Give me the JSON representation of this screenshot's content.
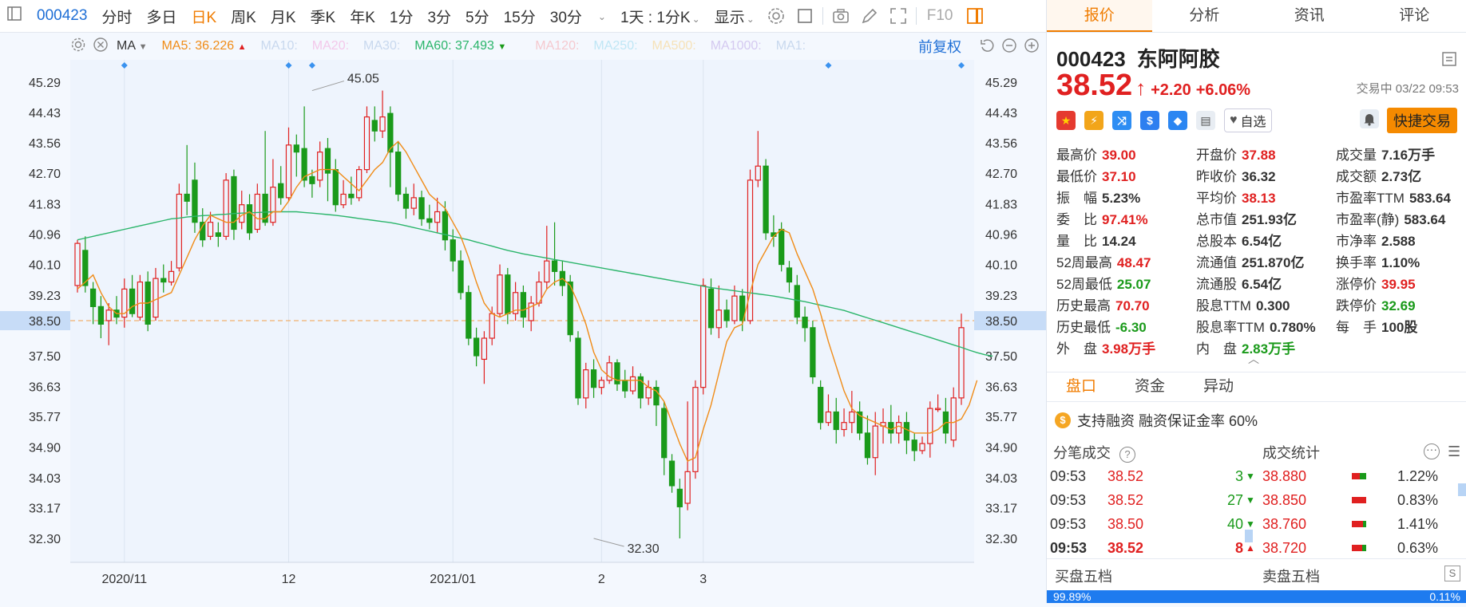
{
  "toolbar": {
    "code": "000423",
    "items": [
      "分时",
      "多日",
      "日K",
      "周K",
      "月K",
      "季K",
      "年K",
      "1分",
      "3分",
      "5分",
      "15分",
      "30分"
    ],
    "active_index": 2,
    "period": "1天 : 1分K",
    "display": "显示",
    "f10": "F10"
  },
  "mabar": {
    "type": "MA",
    "ma5": "MA5: 36.226",
    "ma10": "MA10:",
    "ma20": "MA20:",
    "ma30": "MA30:",
    "ma60": "MA60: 37.493",
    "ma120": "MA120:",
    "ma250": "MA250:",
    "ma500": "MA500:",
    "ma1000": "MA1000:",
    "ma1": "MA1:",
    "fuquan": "前复权"
  },
  "colors": {
    "up": "#e02020",
    "down": "#1a9a1a",
    "ma5": "#f08c18",
    "ma60": "#2bb56b",
    "accent": "#f07c00",
    "blue": "#1f6fd6"
  },
  "chart_data": {
    "type": "candlestick",
    "title": "",
    "y_ticks": [
      "45.29",
      "44.43",
      "43.56",
      "42.70",
      "41.83",
      "40.96",
      "40.10",
      "39.23",
      "38.50",
      "37.50",
      "36.63",
      "35.77",
      "34.90",
      "34.03",
      "33.17",
      "32.30"
    ],
    "x_ticks": [
      {
        "label": "2020/11",
        "index": 6
      },
      {
        "label": "12",
        "index": 27
      },
      {
        "label": "2021/01",
        "index": 48
      },
      {
        "label": "2",
        "index": 67
      },
      {
        "label": "3",
        "index": 80
      }
    ],
    "ylim": [
      31.6,
      46.1
    ],
    "current_price": 38.5,
    "high_annotation": {
      "value": "45.05",
      "index": 30
    },
    "low_annotation": {
      "value": "32.30",
      "index": 66
    },
    "ohlc": [
      [
        39.5,
        40.7,
        40.8,
        39.3
      ],
      [
        40.5,
        39.5,
        40.9,
        39.3
      ],
      [
        39.4,
        38.9,
        39.6,
        38.4
      ],
      [
        38.9,
        38.4,
        39.2,
        38.0
      ],
      [
        38.5,
        38.8,
        39.0,
        37.8
      ],
      [
        38.8,
        38.6,
        39.2,
        38.4
      ],
      [
        38.6,
        39.4,
        39.7,
        38.3
      ],
      [
        39.4,
        38.7,
        39.8,
        38.6
      ],
      [
        38.6,
        39.6,
        39.8,
        38.5
      ],
      [
        39.6,
        38.4,
        39.9,
        38.2
      ],
      [
        38.6,
        39.7,
        40.0,
        38.5
      ],
      [
        39.7,
        39.6,
        40.1,
        39.3
      ],
      [
        39.6,
        39.9,
        40.2,
        39.5
      ],
      [
        40.0,
        42.1,
        42.4,
        39.9
      ],
      [
        42.1,
        41.9,
        43.5,
        41.5
      ],
      [
        42.5,
        41.3,
        43.0,
        41.0
      ],
      [
        41.3,
        40.8,
        41.7,
        40.6
      ],
      [
        40.9,
        41.3,
        41.6,
        40.8
      ],
      [
        41.0,
        40.9,
        41.3,
        40.6
      ],
      [
        40.9,
        42.5,
        42.7,
        40.8
      ],
      [
        42.6,
        41.1,
        42.8,
        40.8
      ],
      [
        41.3,
        41.8,
        42.2,
        41.1
      ],
      [
        41.8,
        41.0,
        42.1,
        40.8
      ],
      [
        41.1,
        42.1,
        42.4,
        41.0
      ],
      [
        42.1,
        41.3,
        43.9,
        41.2
      ],
      [
        41.3,
        42.3,
        43.1,
        41.2
      ],
      [
        42.4,
        42.0,
        42.9,
        41.8
      ],
      [
        42.0,
        43.5,
        44.0,
        41.9
      ],
      [
        43.5,
        43.3,
        43.8,
        42.6
      ],
      [
        43.4,
        42.5,
        44.6,
        42.3
      ],
      [
        42.6,
        42.4,
        42.8,
        42.0
      ],
      [
        42.5,
        43.3,
        43.6,
        42.3
      ],
      [
        43.4,
        42.7,
        43.7,
        41.9
      ],
      [
        42.8,
        41.8,
        43.1,
        41.6
      ],
      [
        41.8,
        42.1,
        42.5,
        41.7
      ],
      [
        42.1,
        42.0,
        42.6,
        41.8
      ],
      [
        42.0,
        42.8,
        42.9,
        41.9
      ],
      [
        42.8,
        44.3,
        44.6,
        42.7
      ],
      [
        44.2,
        43.9,
        44.6,
        43.6
      ],
      [
        43.9,
        44.3,
        45.05,
        43.7
      ],
      [
        44.4,
        43.3,
        44.6,
        42.3
      ],
      [
        43.3,
        42.1,
        43.6,
        41.9
      ],
      [
        42.1,
        41.7,
        42.3,
        41.4
      ],
      [
        41.7,
        42.0,
        42.4,
        41.5
      ],
      [
        42.0,
        41.4,
        42.2,
        41.2
      ],
      [
        41.4,
        41.3,
        41.8,
        41.1
      ],
      [
        41.3,
        41.6,
        42.0,
        41.0
      ],
      [
        41.6,
        40.8,
        41.9,
        40.5
      ],
      [
        40.8,
        40.2,
        41.1,
        39.9
      ],
      [
        40.2,
        39.3,
        40.5,
        39.1
      ],
      [
        39.3,
        38.0,
        39.5,
        37.8
      ],
      [
        38.0,
        37.5,
        38.3,
        37.2
      ],
      [
        37.4,
        38.0,
        38.2,
        36.7
      ],
      [
        38.0,
        38.7,
        38.9,
        37.8
      ],
      [
        38.7,
        39.8,
        40.1,
        38.6
      ],
      [
        39.8,
        38.7,
        40.0,
        38.4
      ],
      [
        38.7,
        39.3,
        39.6,
        38.5
      ],
      [
        39.3,
        38.6,
        39.5,
        38.3
      ],
      [
        38.5,
        39.0,
        39.2,
        38.2
      ],
      [
        39.0,
        39.6,
        39.9,
        38.9
      ],
      [
        39.6,
        40.2,
        41.2,
        39.4
      ],
      [
        40.2,
        39.9,
        41.3,
        39.5
      ],
      [
        39.9,
        39.5,
        40.2,
        39.2
      ],
      [
        39.6,
        38.1,
        39.8,
        37.9
      ],
      [
        38.0,
        36.3,
        38.2,
        36.1
      ],
      [
        36.3,
        37.1,
        37.3,
        36.0
      ],
      [
        37.1,
        36.6,
        37.4,
        36.3
      ],
      [
        36.6,
        36.8,
        36.9,
        36.4
      ],
      [
        36.8,
        37.3,
        37.5,
        36.7
      ],
      [
        37.3,
        36.7,
        37.4,
        36.5
      ],
      [
        36.8,
        36.5,
        37.1,
        36.3
      ],
      [
        36.5,
        36.9,
        37.2,
        36.4
      ],
      [
        36.9,
        36.3,
        37.0,
        36.0
      ],
      [
        36.3,
        36.6,
        36.8,
        36.1
      ],
      [
        36.6,
        36.1,
        36.8,
        35.5
      ],
      [
        36.0,
        34.6,
        36.2,
        34.1
      ],
      [
        34.5,
        33.8,
        34.7,
        33.6
      ],
      [
        33.7,
        33.2,
        34.0,
        32.3
      ],
      [
        33.3,
        34.2,
        36.2,
        33.1
      ],
      [
        34.2,
        36.6,
        36.8,
        34.0
      ],
      [
        36.6,
        39.5,
        39.7,
        36.4
      ],
      [
        39.4,
        38.3,
        39.7,
        38.1
      ],
      [
        38.3,
        38.8,
        39.5,
        38.0
      ],
      [
        38.8,
        38.5,
        39.1,
        38.3
      ],
      [
        38.5,
        39.2,
        39.5,
        38.4
      ],
      [
        39.2,
        38.5,
        39.4,
        38.2
      ],
      [
        38.5,
        42.5,
        42.8,
        38.4
      ],
      [
        42.5,
        42.9,
        43.9,
        42.3
      ],
      [
        42.9,
        41.0,
        43.1,
        40.8
      ],
      [
        41.0,
        40.9,
        41.5,
        40.6
      ],
      [
        41.1,
        40.1,
        41.3,
        39.9
      ],
      [
        40.0,
        39.6,
        40.2,
        39.3
      ],
      [
        39.5,
        38.6,
        39.8,
        38.4
      ],
      [
        38.6,
        38.3,
        38.9,
        37.9
      ],
      [
        38.3,
        36.9,
        38.5,
        36.7
      ],
      [
        36.6,
        35.6,
        36.8,
        35.4
      ],
      [
        35.6,
        35.9,
        36.4,
        35.5
      ],
      [
        35.9,
        35.4,
        36.3,
        35.0
      ],
      [
        35.4,
        35.6,
        36.0,
        35.2
      ],
      [
        35.6,
        35.9,
        36.5,
        35.3
      ],
      [
        35.9,
        35.3,
        36.2,
        35.1
      ],
      [
        35.3,
        34.6,
        35.8,
        34.4
      ],
      [
        34.6,
        35.5,
        35.9,
        34.1
      ],
      [
        35.5,
        35.6,
        36.0,
        35.0
      ],
      [
        35.6,
        35.3,
        36.1,
        35.0
      ],
      [
        35.3,
        35.6,
        35.8,
        35.0
      ],
      [
        35.6,
        35.1,
        35.9,
        34.7
      ],
      [
        35.1,
        34.8,
        35.3,
        34.5
      ],
      [
        34.8,
        35.0,
        35.2,
        34.7
      ],
      [
        35.0,
        36.0,
        36.2,
        34.6
      ],
      [
        36.0,
        36.0,
        36.4,
        35.9
      ],
      [
        35.9,
        35.3,
        36.3,
        35.0
      ],
      [
        35.1,
        36.3,
        36.6,
        34.9
      ],
      [
        36.3,
        38.3,
        38.7,
        36.1
      ]
    ],
    "ma5_line": [
      39.4,
      39.6,
      39.8,
      39.3,
      38.9,
      38.7,
      38.7,
      38.9,
      39.0,
      39.0,
      39.1,
      39.2,
      39.3,
      39.8,
      40.3,
      40.8,
      41.2,
      41.5,
      41.4,
      41.3,
      41.3,
      41.5,
      41.6,
      41.4,
      41.4,
      41.6,
      41.6,
      41.9,
      42.3,
      42.6,
      42.7,
      42.8,
      42.8,
      42.8,
      42.6,
      42.4,
      42.2,
      42.5,
      42.8,
      43.0,
      43.4,
      43.6,
      43.3,
      42.9,
      42.5,
      42.1,
      41.9,
      41.7,
      41.3,
      40.9,
      40.3,
      39.6,
      39.0,
      38.7,
      38.6,
      38.7,
      38.8,
      38.8,
      38.9,
      39.0,
      39.4,
      39.6,
      39.7,
      39.5,
      39.0,
      38.4,
      37.6,
      37.1,
      36.9,
      36.8,
      36.8,
      36.8,
      36.8,
      36.6,
      36.5,
      36.2,
      35.6,
      35.0,
      34.5,
      34.6,
      35.4,
      36.1,
      37.0,
      37.9,
      38.3,
      38.4,
      39.3,
      40.1,
      40.5,
      40.9,
      41.1,
      41.0,
      40.4,
      39.9,
      39.4,
      38.7,
      37.9,
      37.2,
      36.5,
      36.0,
      35.8,
      35.7,
      35.6,
      35.5,
      35.4,
      35.5,
      35.4,
      35.3,
      35.3,
      35.3,
      35.4,
      35.6,
      35.6,
      35.7,
      36.1,
      36.8
    ],
    "ma60_line": [
      40.8,
      40.85,
      40.9,
      40.95,
      41.0,
      41.05,
      41.1,
      41.15,
      41.2,
      41.25,
      41.3,
      41.35,
      41.4,
      41.42,
      41.45,
      41.47,
      41.49,
      41.5,
      41.52,
      41.53,
      41.55,
      41.56,
      41.57,
      41.58,
      41.59,
      41.6,
      41.6,
      41.6,
      41.6,
      41.58,
      41.56,
      41.54,
      41.52,
      41.5,
      41.47,
      41.44,
      41.41,
      41.38,
      41.35,
      41.32,
      41.29,
      41.25,
      41.2,
      41.15,
      41.1,
      41.05,
      41.0,
      40.95,
      40.9,
      40.85,
      40.8,
      40.74,
      40.68,
      40.62,
      40.56,
      40.5,
      40.45,
      40.4,
      40.36,
      40.32,
      40.28,
      40.24,
      40.2,
      40.16,
      40.12,
      40.08,
      40.04,
      40.0,
      39.96,
      39.92,
      39.88,
      39.84,
      39.8,
      39.76,
      39.72,
      39.68,
      39.64,
      39.6,
      39.56,
      39.52,
      39.48,
      39.44,
      39.41,
      39.38,
      39.35,
      39.32,
      39.29,
      39.26,
      39.23,
      39.2,
      39.16,
      39.12,
      39.08,
      39.04,
      38.99,
      38.94,
      38.89,
      38.84,
      38.79,
      38.72,
      38.65,
      38.58,
      38.51,
      38.44,
      38.37,
      38.3,
      38.23,
      38.16,
      38.09,
      38.02,
      37.95,
      37.88,
      37.81,
      37.74,
      37.66,
      37.59,
      37.53,
      37.49
    ]
  },
  "right": {
    "tabs": [
      "报价",
      "分析",
      "资讯",
      "评论"
    ],
    "code": "000423",
    "name": "东阿阿胶",
    "price": "38.52",
    "change": "+2.20",
    "change_pct": "+6.06%",
    "status": "交易中 03/22 09:53",
    "zixuan": "自选",
    "quick_trade": "快捷交易",
    "stats": [
      [
        {
          "l": "最高价",
          "v": "39.00",
          "c": "red"
        },
        {
          "l": "开盘价",
          "v": "37.88",
          "c": "red"
        },
        {
          "l": "成交量",
          "v": "7.16万手",
          "c": "dark"
        }
      ],
      [
        {
          "l": "最低价",
          "v": "37.10",
          "c": "red"
        },
        {
          "l": "昨收价",
          "v": "36.32",
          "c": "dark"
        },
        {
          "l": "成交额",
          "v": "2.73亿",
          "c": "dark"
        }
      ],
      [
        {
          "l": "振　幅",
          "v": "5.23%",
          "c": "dark"
        },
        {
          "l": "平均价",
          "v": "38.13",
          "c": "red"
        },
        {
          "l": "市盈率TTM",
          "v": "583.64",
          "c": "dark"
        }
      ],
      [
        {
          "l": "委　比",
          "v": "97.41%",
          "c": "red"
        },
        {
          "l": "总市值",
          "v": "251.93亿",
          "c": "dark"
        },
        {
          "l": "市盈率(静)",
          "v": "583.64",
          "c": "dark"
        }
      ],
      [
        {
          "l": "量　比",
          "v": "14.24",
          "c": "dark"
        },
        {
          "l": "总股本",
          "v": "6.54亿",
          "c": "dark"
        },
        {
          "l": "市净率",
          "v": "2.588",
          "c": "dark"
        }
      ],
      [
        {
          "l": "52周最高",
          "v": "48.47",
          "c": "red"
        },
        {
          "l": "流通值",
          "v": "251.870亿",
          "c": "dark"
        },
        {
          "l": "换手率",
          "v": "1.10%",
          "c": "dark"
        }
      ],
      [
        {
          "l": "52周最低",
          "v": "25.07",
          "c": "green"
        },
        {
          "l": "流通股",
          "v": "6.54亿",
          "c": "dark"
        },
        {
          "l": "涨停价",
          "v": "39.95",
          "c": "red"
        }
      ],
      [
        {
          "l": "历史最高",
          "v": "70.70",
          "c": "red"
        },
        {
          "l": "股息TTM",
          "v": "0.300",
          "c": "dark"
        },
        {
          "l": "跌停价",
          "v": "32.69",
          "c": "green"
        }
      ],
      [
        {
          "l": "历史最低",
          "v": "-6.30",
          "c": "green"
        },
        {
          "l": "股息率TTM",
          "v": "0.780%",
          "c": "dark"
        },
        {
          "l": "每　手",
          "v": "100股",
          "c": "dark"
        }
      ],
      [
        {
          "l": "外　盘",
          "v": "3.98万手",
          "c": "red"
        },
        {
          "l": "内　盘",
          "v": "2.83万手",
          "c": "green"
        }
      ]
    ],
    "subtabs": [
      "盘口",
      "资金",
      "异动"
    ],
    "margin_text": "支持融资  融资保证金率 60%",
    "ticks_title": "分笔成交",
    "dist_title": "成交统计",
    "ticks": [
      {
        "t": "09:53",
        "p": "38.52",
        "v": "3",
        "dir": "down"
      },
      {
        "t": "09:53",
        "p": "38.52",
        "v": "27",
        "dir": "down"
      },
      {
        "t": "09:53",
        "p": "38.50",
        "v": "40",
        "dir": "down"
      },
      {
        "t": "09:53",
        "p": "38.52",
        "v": "8",
        "dir": "up"
      }
    ],
    "dist": [
      {
        "p": "38.880",
        "pct": "1.22%",
        "g": 0.45
      },
      {
        "p": "38.850",
        "pct": "0.83%",
        "g": 0.0
      },
      {
        "p": "38.760",
        "pct": "1.41%",
        "g": 0.2
      },
      {
        "p": "38.720",
        "pct": "0.63%",
        "g": 0.3
      }
    ],
    "buy5": "买盘五档",
    "sell5": "卖盘五档",
    "buy_pct": "99.89%",
    "sell_pct": "0.11%"
  }
}
